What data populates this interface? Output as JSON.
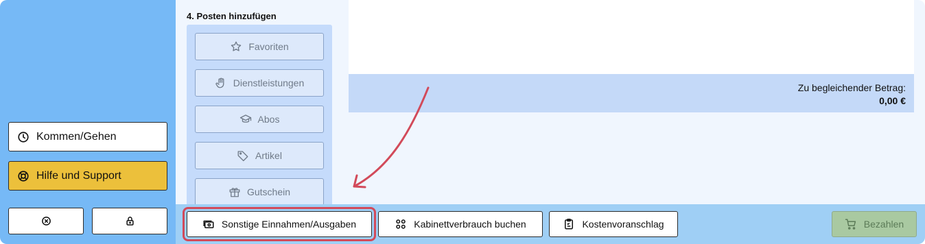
{
  "sidebar": {
    "kommen_gehen": {
      "label": "Kommen/Gehen",
      "icon": "clock-icon"
    },
    "hilfe_support": {
      "label": "Hilfe und Support",
      "icon": "lifebuoy-icon"
    },
    "close_icon": "close-circle-icon",
    "lock_icon": "lock-icon"
  },
  "posten": {
    "title": "4. Posten hinzufügen",
    "items": [
      {
        "label": "Favoriten",
        "icon": "star-icon"
      },
      {
        "label": "Dienstleistungen",
        "icon": "hand-icon"
      },
      {
        "label": "Abos",
        "icon": "graduation-cap-icon"
      },
      {
        "label": "Artikel",
        "icon": "tag-icon"
      },
      {
        "label": "Gutschein",
        "icon": "gift-icon"
      }
    ]
  },
  "summary": {
    "betrag_label": "Zu begleichender Betrag:",
    "betrag_value": "0,00 €"
  },
  "bottom": {
    "sonstige": {
      "label": "Sonstige Einnahmen/Ausgaben",
      "icon": "cash-icon"
    },
    "kabinett": {
      "label": "Kabinettverbrauch buchen",
      "icon": "grid-icon"
    },
    "kostenvoranschlag": {
      "label": "Kostenvoranschlag",
      "icon": "clipboard-icon"
    },
    "bezahlen": {
      "label": "Bezahlen",
      "icon": "cart-icon"
    }
  },
  "colors": {
    "sidebar": "#76b9f6",
    "help_button": "#ecc03b",
    "highlight": "#d24a5a",
    "pay_button": "#a9c9a1"
  }
}
